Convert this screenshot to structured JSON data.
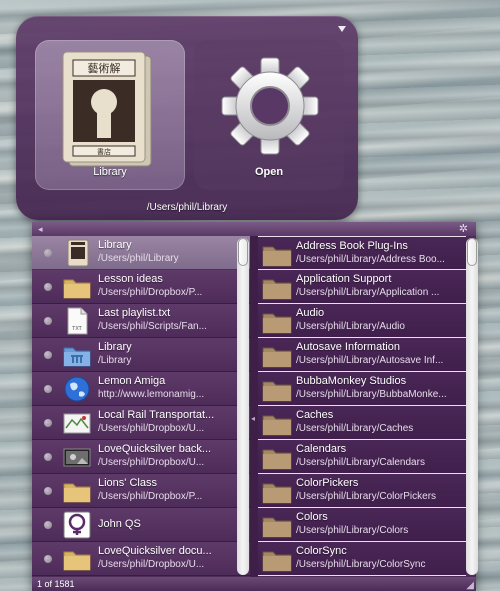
{
  "command_panes": {
    "first_pane": {
      "label": "Library",
      "icon": "library-book-icon"
    },
    "second_pane": {
      "label": "Open",
      "icon": "gear-icon"
    },
    "path": "/Users/phil/Library"
  },
  "results_window": {
    "left_list": [
      {
        "title": "Library",
        "subtitle": "/Users/phil/Library",
        "icon": "library-book-icon",
        "selected": true,
        "has_children": true
      },
      {
        "title": "Lesson ideas",
        "subtitle": "/Users/phil/Dropbox/P...",
        "icon": "folder-icon",
        "selected": false,
        "has_children": true
      },
      {
        "title": "Last playlist.txt",
        "subtitle": "/Users/phil/Scripts/Fan...",
        "icon": "text-file-icon",
        "selected": false,
        "has_children": false
      },
      {
        "title": "Library",
        "subtitle": "/Library",
        "icon": "library-folder-icon",
        "selected": false,
        "has_children": true
      },
      {
        "title": "Lemon Amiga",
        "subtitle": "http://www.lemonamig...",
        "icon": "globe-icon",
        "selected": false,
        "has_children": false
      },
      {
        "title": "Local Rail Transportat...",
        "subtitle": "/Users/phil/Dropbox/U...",
        "icon": "map-image-icon",
        "selected": false,
        "has_children": false
      },
      {
        "title": "LoveQuicksilver back...",
        "subtitle": "/Users/phil/Dropbox/U...",
        "icon": "photo-icon",
        "selected": false,
        "has_children": false
      },
      {
        "title": "Lions' Class",
        "subtitle": "/Users/phil/Dropbox/P...",
        "icon": "folder-icon",
        "selected": false,
        "has_children": true
      },
      {
        "title": "John QS",
        "subtitle": "",
        "icon": "contact-icon",
        "selected": false,
        "has_children": false
      },
      {
        "title": "LoveQuicksilver docu...",
        "subtitle": "/Users/phil/Dropbox/U...",
        "icon": "folder-icon",
        "selected": false,
        "has_children": true
      }
    ],
    "right_list": [
      {
        "title": "Address Book Plug-Ins",
        "subtitle": "/Users/phil/Library/Address Boo..."
      },
      {
        "title": "Application Support",
        "subtitle": "/Users/phil/Library/Application ..."
      },
      {
        "title": "Audio",
        "subtitle": "/Users/phil/Library/Audio"
      },
      {
        "title": "Autosave Information",
        "subtitle": "/Users/phil/Library/Autosave Inf..."
      },
      {
        "title": "BubbaMonkey Studios",
        "subtitle": "/Users/phil/Library/BubbaMonke..."
      },
      {
        "title": "Caches",
        "subtitle": "/Users/phil/Library/Caches"
      },
      {
        "title": "Calendars",
        "subtitle": "/Users/phil/Library/Calendars"
      },
      {
        "title": "ColorPickers",
        "subtitle": "/Users/phil/Library/ColorPickers"
      },
      {
        "title": "Colors",
        "subtitle": "/Users/phil/Library/Colors"
      },
      {
        "title": "ColorSync",
        "subtitle": "/Users/phil/Library/ColorSync"
      }
    ],
    "status": "1 of 1581"
  }
}
